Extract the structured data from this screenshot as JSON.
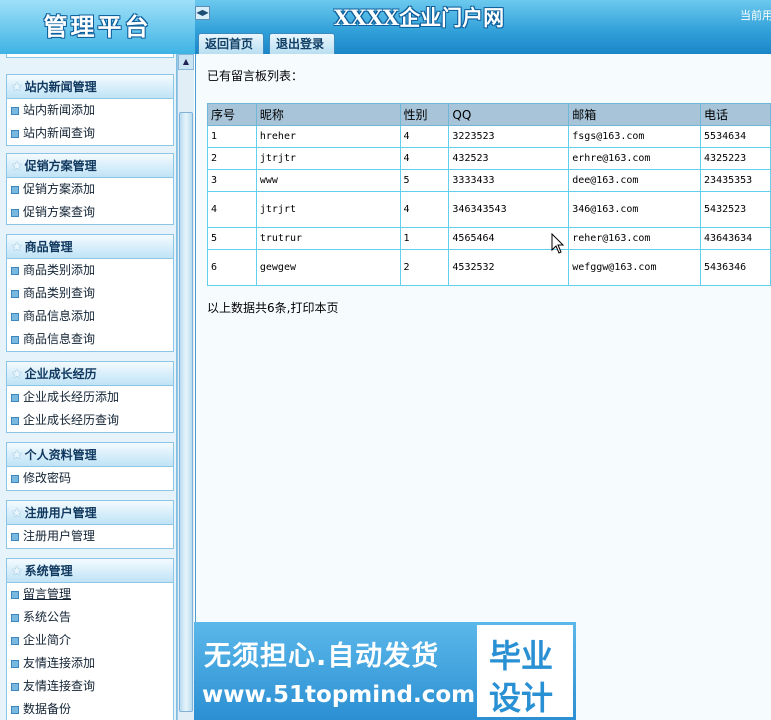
{
  "header": {
    "logo_text": "管理平台",
    "site_title": "XXXX企业门户网",
    "current_user_text": "当前用",
    "toggle_symbol": "◀▶",
    "tabs": [
      {
        "label": "返回首页"
      },
      {
        "label": "退出登录"
      }
    ]
  },
  "sidebar": {
    "groups": [
      {
        "title": "站内新闻管理",
        "items": [
          "站内新闻添加",
          "站内新闻查询"
        ]
      },
      {
        "title": "促销方案管理",
        "items": [
          "促销方案添加",
          "促销方案查询"
        ]
      },
      {
        "title": "商品管理",
        "items": [
          "商品类别添加",
          "商品类别查询",
          "商品信息添加",
          "商品信息查询"
        ]
      },
      {
        "title": "企业成长经历",
        "items": [
          "企业成长经历添加",
          "企业成长经历查询"
        ]
      },
      {
        "title": "个人资料管理",
        "items": [
          "修改密码"
        ]
      },
      {
        "title": "注册用户管理",
        "items": [
          "注册用户管理"
        ]
      },
      {
        "title": "系统管理",
        "items": [
          "留言管理",
          "系统公告",
          "企业简介",
          "友情连接添加",
          "友情连接查询",
          "数据备份"
        ]
      }
    ]
  },
  "main": {
    "list_title": "已有留言板列表：",
    "columns": [
      "序号",
      "昵称",
      "性别",
      "QQ",
      "邮箱",
      "电话"
    ],
    "rows": [
      [
        "1",
        "hreher",
        "4",
        "3223523",
        "fsgs@163.com",
        "5534634"
      ],
      [
        "2",
        "jtrjtr",
        "4",
        "432523",
        "erhre@163.com",
        "4325223"
      ],
      [
        "3",
        "www",
        "5",
        "3333433",
        "dee@163.com",
        "23435353"
      ],
      [
        "4",
        "jtrjrt",
        "4",
        "346343543",
        "346@163.com",
        "5432523"
      ],
      [
        "5",
        "trutrur",
        "1",
        "4565464",
        "reher@163.com",
        "43643634"
      ],
      [
        "6",
        "gewgew",
        "2",
        "4532532",
        "wefggw@163.com",
        "5436346"
      ]
    ],
    "summary_prefix": "以上数据共6条,",
    "print_link": "打印本页"
  },
  "watermark": {
    "line1": "无须担心.自动发货",
    "line2": "www.51topmind.com",
    "badge1": "毕业",
    "badge2": "设计"
  }
}
